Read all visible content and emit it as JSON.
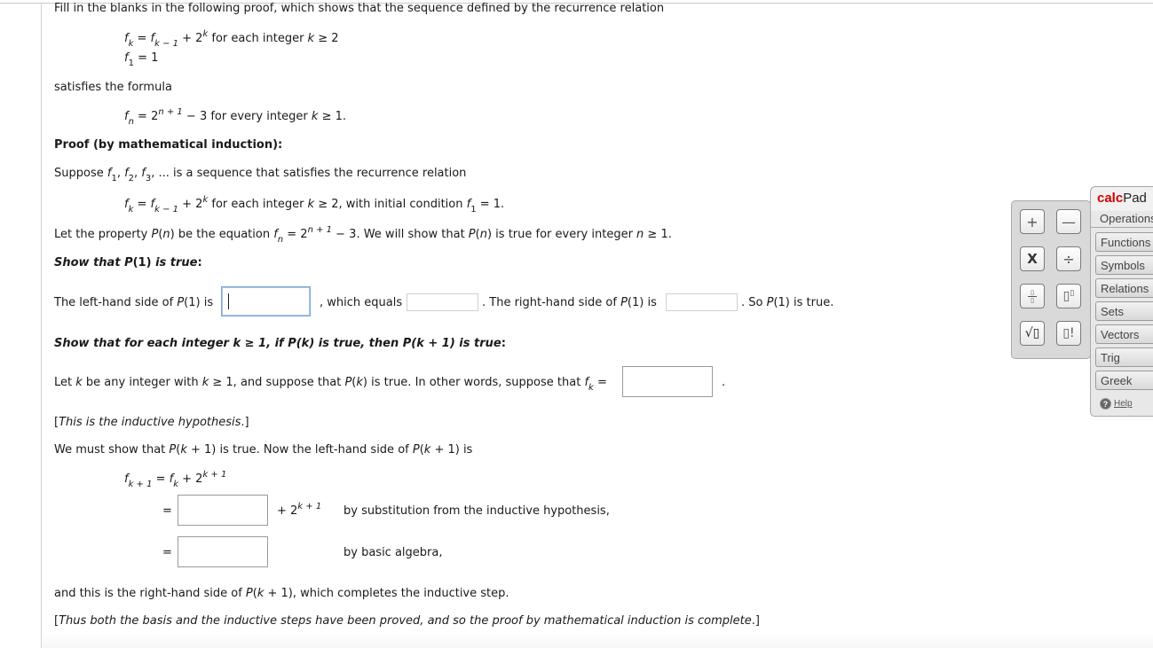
{
  "problem": {
    "intro": "Fill in the blanks in the following proof, which shows that the sequence defined by the recurrence relation",
    "recurrence_line1": {
      "lhs": "f",
      "lhs_sub": "k",
      "eq": " = ",
      "f": "f",
      "f_sub": "k − 1",
      "plus": " + 2",
      "exp": "k",
      "tail": " for each integer ",
      "var": "k",
      "cond": " ≥ 2"
    },
    "recurrence_line2": {
      "lhs": "f",
      "lhs_sub": "1",
      "eq": " = 1"
    },
    "satisfies": "satisfies the formula",
    "formula": {
      "lhs": "f",
      "lhs_sub": "n",
      "eq": " = 2",
      "exp": "n + 1",
      "tail": " − 3 for every integer ",
      "var": "k",
      "cond": " ≥ 1."
    },
    "proof_heading": "Proof (by mathematical induction):",
    "suppose": {
      "pre": "Suppose ",
      "f1": "f",
      "s1": "1",
      "f2": "f",
      "s2": "2",
      "f3": "f",
      "s3": "3",
      "post": ", ... is a sequence that satisfies the recurrence relation"
    },
    "recurrence_restated": {
      "lhs": "f",
      "lhs_sub": "k",
      "eq": " = ",
      "f": "f",
      "f_sub": "k − 1",
      "plus": " + 2",
      "exp": "k",
      "tail": " for each integer ",
      "var": "k",
      "cond": " ≥ 2, with initial condition ",
      "f1": "f",
      "f1_sub": "1",
      "end": " = 1."
    },
    "property": {
      "pre": "Let the property ",
      "P": "P",
      "n": "n",
      "mid": ") be the equation ",
      "f": "f",
      "f_sub": "n",
      "eq": " = 2",
      "exp": "n + 1",
      "tail": " − 3. We will show that ",
      "P2": "P",
      "n2": "n",
      "tail2": ") is true for every integer ",
      "n3": "n",
      "end": " ≥ 1."
    },
    "basis_heading": {
      "a": "Show that ",
      "b": "P",
      "c": "(1) ",
      "d": "is true",
      "e": ":"
    },
    "basis_line": {
      "a": "The left-hand side of ",
      "P": "P",
      "b": "(1) is",
      "c": ", which equals",
      "d": ". The right-hand side of ",
      "P2": "P",
      "e": "(1) is",
      "f": ". So ",
      "P3": "P",
      "g": "(1) is true."
    },
    "inductive_heading": "Show that for each integer k ≥ 1, if P(k) is true, then P(k + 1) is true",
    "inductive_heading_colon": ":",
    "hypothesis_line": {
      "a": "Let ",
      "k": "k",
      "b": " be any integer with ",
      "k2": "k",
      "c": " ≥ 1, and suppose that ",
      "P": "P",
      "k3": "k",
      "d": ") is true. In other words, suppose that ",
      "f": "f",
      "f_sub": "k",
      "eq": " =",
      "end": "."
    },
    "hypothesis_note": {
      "a": "[",
      "b": "This is the inductive hypothesis",
      "c": ".]"
    },
    "must_show": {
      "a": "We must show that ",
      "P": "P",
      "k": "k",
      "b": " + 1) is true. Now the left-hand side of ",
      "P2": "P",
      "k2": "k",
      "c": " + 1) is"
    },
    "step1": {
      "f": "f",
      "f_sub": "k + 1",
      "eq": " = ",
      "f2": "f",
      "f2_sub": "k",
      "plus": " + 2",
      "exp": "k + 1"
    },
    "step2": {
      "eq": "=",
      "plus": "+ 2",
      "exp": "k + 1",
      "reason": "by substitution from the inductive hypothesis,"
    },
    "step3": {
      "eq": "=",
      "reason": "by basic algebra,"
    },
    "conclusion": {
      "a": "and this is the right-hand side of ",
      "P": "P",
      "k": "k",
      "b": " + 1), which completes the inductive step."
    },
    "final_note": {
      "a": "[",
      "b": "Thus both the basis and the inductive steps have been proved, and so the proof by mathematical induction is complete",
      "c": ".]"
    }
  },
  "inputs": {
    "basis_lhs": "",
    "basis_lhs_value": "",
    "basis_rhs": "",
    "hypothesis": "",
    "substitution": "",
    "algebra": ""
  },
  "calcpad": {
    "brand_calc": "calc",
    "brand_pad": "Pad",
    "operations_label": "Operations",
    "buttons": [
      "+",
      "−",
      "x",
      "÷",
      "fraction",
      "exponent",
      "square-root",
      "factorial"
    ],
    "button_glyphs": {
      "plus": "+",
      "minus": "—",
      "times": "X",
      "divide": "÷",
      "frac_num": "▯",
      "frac_den": "▯",
      "pow": "▯",
      "pow_exp": "▯",
      "sqrt": "√▯",
      "fact": "▯!"
    },
    "categories": [
      "Functions",
      "Symbols",
      "Relations",
      "Sets",
      "Vectors",
      "Trig",
      "Greek"
    ],
    "help": "Help",
    "brand_color": "#d40000"
  }
}
